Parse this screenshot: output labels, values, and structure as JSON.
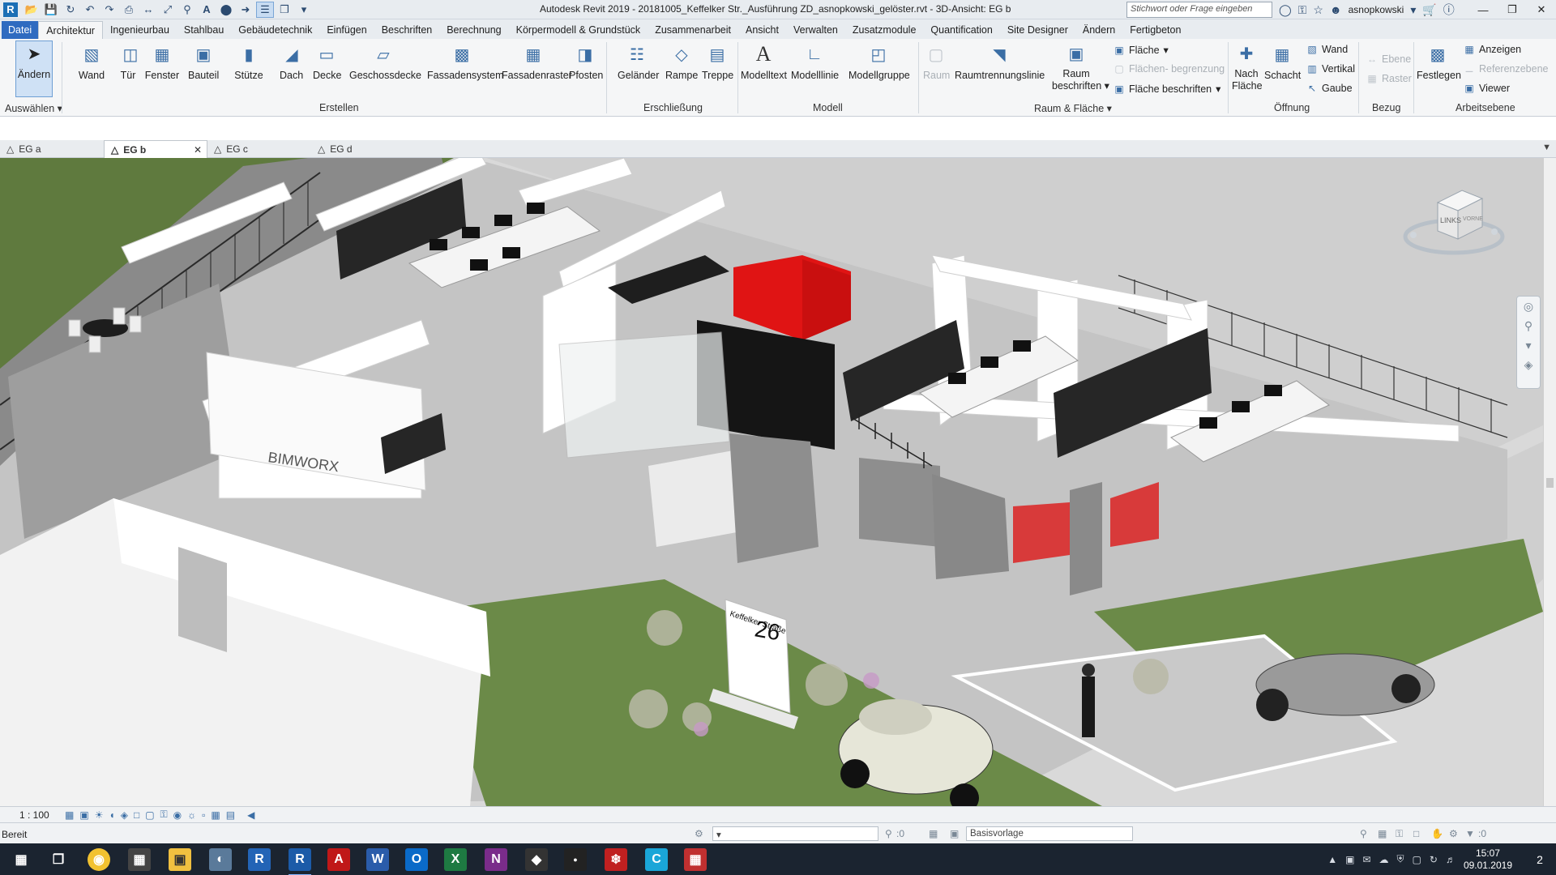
{
  "titlebar": {
    "title": "Autodesk Revit 2019 - 20181005_Keffelker Str._Ausführung ZD_asnopkowski_gelöster.rvt - 3D-Ansicht: EG b",
    "search_placeholder": "Stichwort oder Frage eingeben",
    "username": "asnopkowski",
    "app_logo": "R"
  },
  "menu_tabs": [
    {
      "label": "Datei"
    },
    {
      "label": "Architektur"
    },
    {
      "label": "Ingenieurbau"
    },
    {
      "label": "Stahlbau"
    },
    {
      "label": "Gebäudetechnik"
    },
    {
      "label": "Einfügen"
    },
    {
      "label": "Beschriften"
    },
    {
      "label": "Berechnung"
    },
    {
      "label": "Körpermodell & Grundstück"
    },
    {
      "label": "Zusammenarbeit"
    },
    {
      "label": "Ansicht"
    },
    {
      "label": "Verwalten"
    },
    {
      "label": "Zusatzmodule"
    },
    {
      "label": "Quantification"
    },
    {
      "label": "Site Designer"
    },
    {
      "label": "Ändern"
    },
    {
      "label": "Fertigbeton"
    }
  ],
  "active_tab": "Architektur",
  "ribbon": {
    "modify": "Ändern",
    "select_panel": "Auswählen",
    "build_panel": "Erstellen",
    "build_tools": [
      "Wand",
      "Tür",
      "Fenster",
      "Bauteil",
      "Stütze",
      "Dach",
      "Decke",
      "Geschossdecke",
      "Fassadensystem",
      "Fassadenraster",
      "Pfosten"
    ],
    "circulation_panel": "Erschließung",
    "circulation_tools": [
      "Geländer",
      "Rampe",
      "Treppe"
    ],
    "model_panel": "Modell",
    "model_tools": [
      "Modelltext",
      "Modelllinie",
      "Modellgruppe"
    ],
    "room_panel": "Raum & Fläche",
    "room_tool": "Raum",
    "room_separator": "Raumtrennungslinie",
    "room_tag_line1": "Raum",
    "room_tag_line2": "beschriften",
    "area": "Fläche",
    "area_boundary": "Flächen- begrenzung",
    "area_tag": "Fläche beschriften",
    "opening_panel": "Öffnung",
    "by_face_line1": "Nach",
    "by_face_line2": "Fläche",
    "shaft": "Schacht",
    "wall_opening": "Wand",
    "vertical": "Vertikal",
    "dormer": "Gaube",
    "datum_panel": "Bezug",
    "level": "Ebene",
    "grid": "Raster",
    "workplane_panel": "Arbeitsebene",
    "set": "Festlegen",
    "show": "Anzeigen",
    "ref_plane": "Referenzebene",
    "viewer": "Viewer"
  },
  "view_tabs": [
    {
      "label": "EG a"
    },
    {
      "label": "EG b"
    },
    {
      "label": "EG c"
    },
    {
      "label": "EG d"
    }
  ],
  "active_view": "EG b",
  "viewport": {
    "logo_text": "BIMWORX",
    "street_sign": "Keffelker Straße",
    "house_number": "26",
    "viewcube_label_left": "LINKS",
    "viewcube_label_front": "VORNE"
  },
  "view_control": {
    "scale": "1 : 100"
  },
  "status": {
    "text": "Bereit",
    "zero_a": ":0",
    "template": "Basisvorlage",
    "zero_b": ":0"
  },
  "taskbar": {
    "time": "15:07",
    "date": "09.01.2019",
    "notifications": "2"
  },
  "colors": {
    "accent": "#2f6bc0",
    "ribbon_bg": "#f5f6f7",
    "highlight_red": "#e01414"
  }
}
